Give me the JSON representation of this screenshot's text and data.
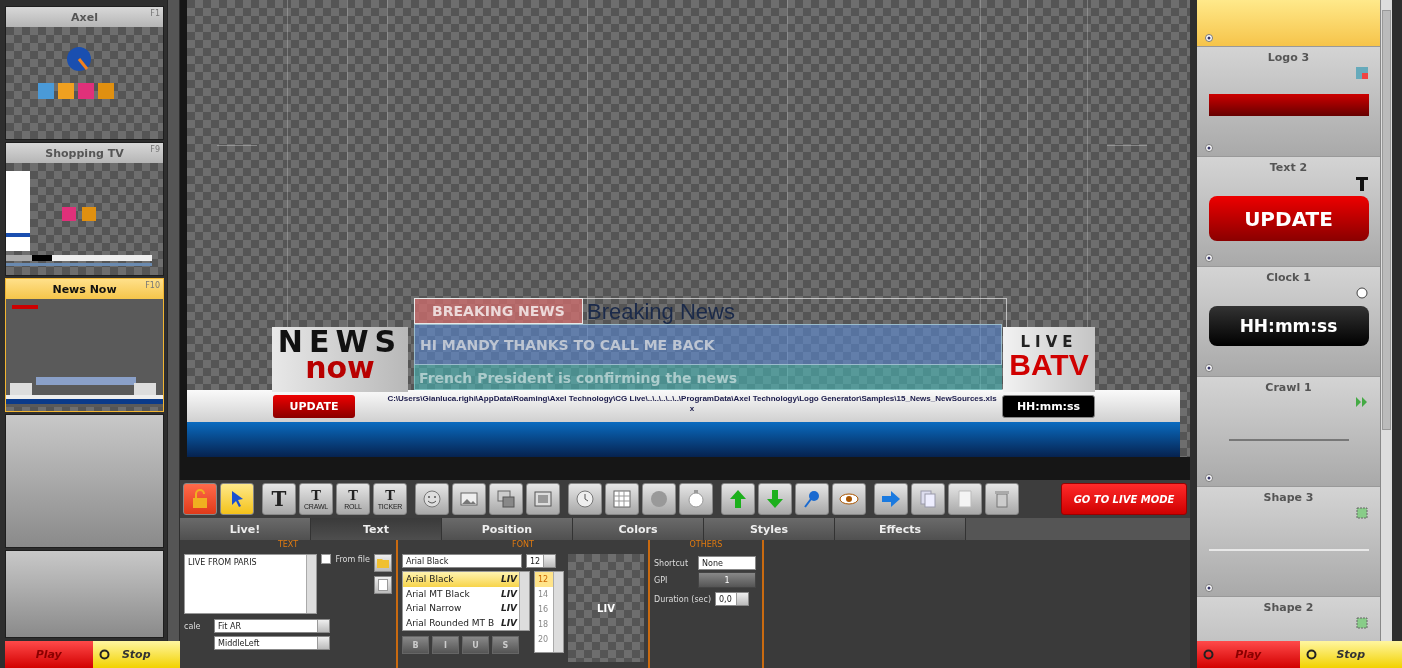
{
  "left_panel": {
    "cards": [
      {
        "kind": "logos",
        "title": "Axel",
        "key": "F1",
        "selected": false
      },
      {
        "kind": "shop",
        "title": "Shopping TV",
        "key": "F9",
        "selected": false
      },
      {
        "kind": "news",
        "title": "News Now",
        "key": "F10",
        "selected": true
      },
      {
        "kind": "empty",
        "selected": false
      },
      {
        "kind": "empty",
        "selected": false
      }
    ],
    "play": "Play",
    "stop": "Stop"
  },
  "canvas": {
    "breaking_tag": "BREAKING NEWS",
    "breaking_title": "Breaking News",
    "line_1": "HI MANDY THANKS TO CALL ME BACK",
    "line_2": "French President is confirming the news",
    "logo_top": "NEWS",
    "logo_bottom": "now",
    "live": "LIVE",
    "channel": "BATV",
    "update": "UPDATE",
    "source_path": "C:\\Users\\Gianluca.righi\\AppData\\Roaming\\Axel Technology\\CG Live\\..\\..\\..\\..\\..\\ProgramData\\Axel Technology\\Logo Generator\\Samples\\15_News_NewSources.xlsx",
    "clock": "HH:mm:ss"
  },
  "toolbar": {
    "groups": [
      [
        {
          "kind": "lock",
          "selected": false
        },
        {
          "kind": "pointer",
          "selected": true
        }
      ],
      [
        {
          "kind": "text",
          "glyph": "T",
          "selected": false
        },
        {
          "kind": "text",
          "glyph": "T",
          "caption": "CRAWL",
          "selected": false
        },
        {
          "kind": "text",
          "glyph": "T",
          "caption": "ROLL",
          "selected": false
        },
        {
          "kind": "text",
          "glyph": "T",
          "caption": "TICKER",
          "selected": false
        }
      ],
      [
        {
          "kind": "face",
          "selected": false
        },
        {
          "kind": "image",
          "selected": false
        },
        {
          "kind": "images",
          "selected": false
        },
        {
          "kind": "frame",
          "selected": false
        }
      ],
      [
        {
          "kind": "clock",
          "selected": false
        },
        {
          "kind": "table",
          "selected": false
        },
        {
          "kind": "circle",
          "selected": false
        },
        {
          "kind": "timer",
          "selected": false
        }
      ],
      [
        {
          "kind": "up",
          "selected": false
        },
        {
          "kind": "down",
          "selected": false
        },
        {
          "kind": "pin",
          "selected": false
        },
        {
          "kind": "eye",
          "selected": false
        }
      ],
      [
        {
          "kind": "forward",
          "selected": false
        },
        {
          "kind": "copy",
          "selected": false
        },
        {
          "kind": "page",
          "selected": false
        },
        {
          "kind": "trash",
          "selected": false
        }
      ]
    ],
    "live_button": "GO TO LIVE MODE"
  },
  "tabs": [
    {
      "label": "Live!",
      "selected": false
    },
    {
      "label": "Text",
      "selected": true
    },
    {
      "label": "Position",
      "selected": false
    },
    {
      "label": "Colors",
      "selected": false
    },
    {
      "label": "Styles",
      "selected": false
    },
    {
      "label": "Effects",
      "selected": false
    }
  ],
  "properties": {
    "text": {
      "heading": "TEXT",
      "value": "LIVE FROM PARIS",
      "from_file": {
        "label": "From file",
        "checked": false
      },
      "scale_label": "cale",
      "scale": "Fit AR",
      "align": "MiddleLeft"
    },
    "font": {
      "heading": "FONT",
      "family": "Arial Black",
      "size": "12",
      "families": [
        {
          "name": "Arial Black",
          "sample": "LIV",
          "selected": true
        },
        {
          "name": "Arial MT Black",
          "sample": "LIV",
          "selected": false
        },
        {
          "name": "Arial Narrow",
          "sample": "LIV",
          "selected": false
        },
        {
          "name": "Arial Rounded MT B",
          "sample": "LIV",
          "selected": false
        }
      ],
      "sizes": [
        {
          "label": "12",
          "selected": true
        },
        {
          "label": "14",
          "selected": false
        },
        {
          "label": "16",
          "selected": false
        },
        {
          "label": "18",
          "selected": false
        },
        {
          "label": "20",
          "selected": false
        }
      ],
      "styles": [
        "B",
        "I",
        "U",
        "S"
      ],
      "preview": "LIV"
    },
    "others": {
      "heading": "OTHERS",
      "shortcut_label": "Shortcut",
      "shortcut": "None",
      "gpi_label": "GPI",
      "gpi": "1",
      "duration_label": "Duration (sec)",
      "duration": "0,0"
    }
  },
  "right_panel": {
    "items": [
      {
        "kind": "cut",
        "selected": true
      },
      {
        "kind": "logo",
        "title": "Logo 3",
        "selected": false
      },
      {
        "kind": "text",
        "title": "Text 2",
        "preview": "UPDATE",
        "selected": false
      },
      {
        "kind": "clock",
        "title": "Clock 1",
        "preview": "HH:mm:ss",
        "selected": false
      },
      {
        "kind": "crawl",
        "title": "Crawl 1",
        "selected": false
      },
      {
        "kind": "shape",
        "title": "Shape 3",
        "selected": false
      },
      {
        "kind": "shape",
        "title": "Shape 2",
        "selected": false
      }
    ],
    "play": "Play",
    "stop": "Stop"
  }
}
